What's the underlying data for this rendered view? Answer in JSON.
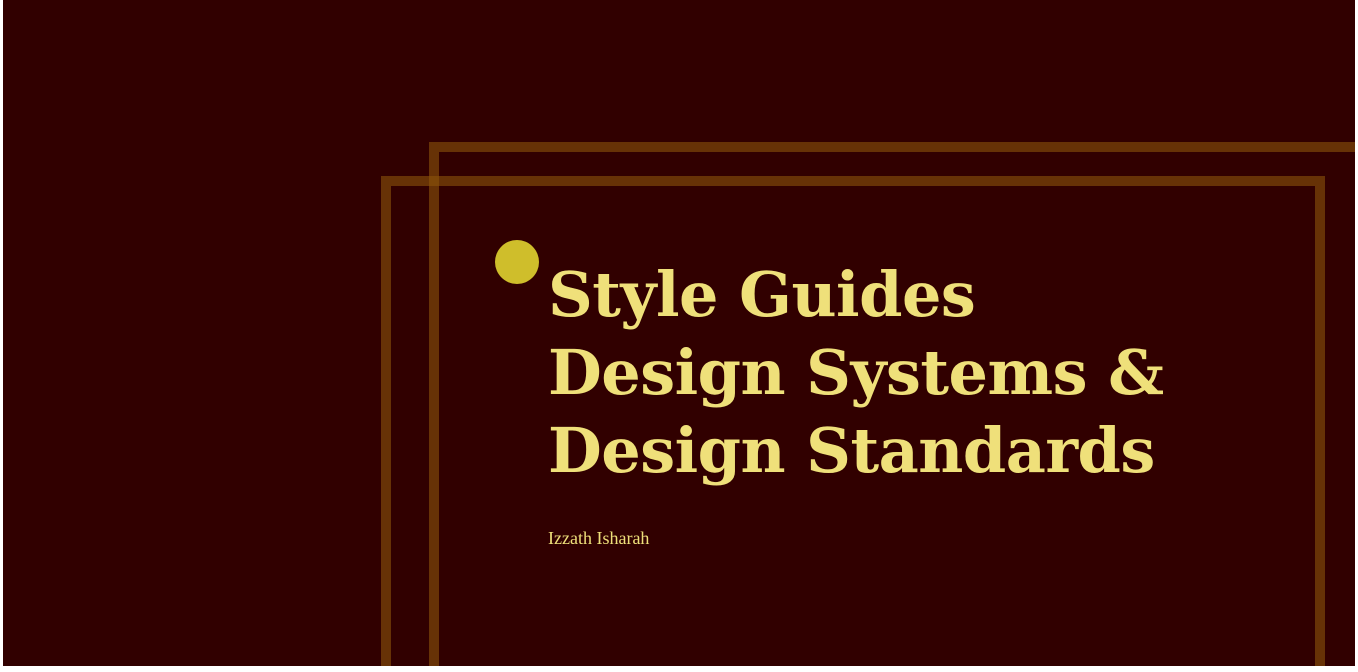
{
  "slide": {
    "title_lines": [
      "Style Guides",
      "Design Systems &",
      "Design Standards"
    ],
    "author": "Izzath Isharah"
  },
  "colors": {
    "background": "#310000",
    "text": "#efe07a",
    "accent_dot": "#cfbe2b",
    "frame": "#8c540a"
  }
}
